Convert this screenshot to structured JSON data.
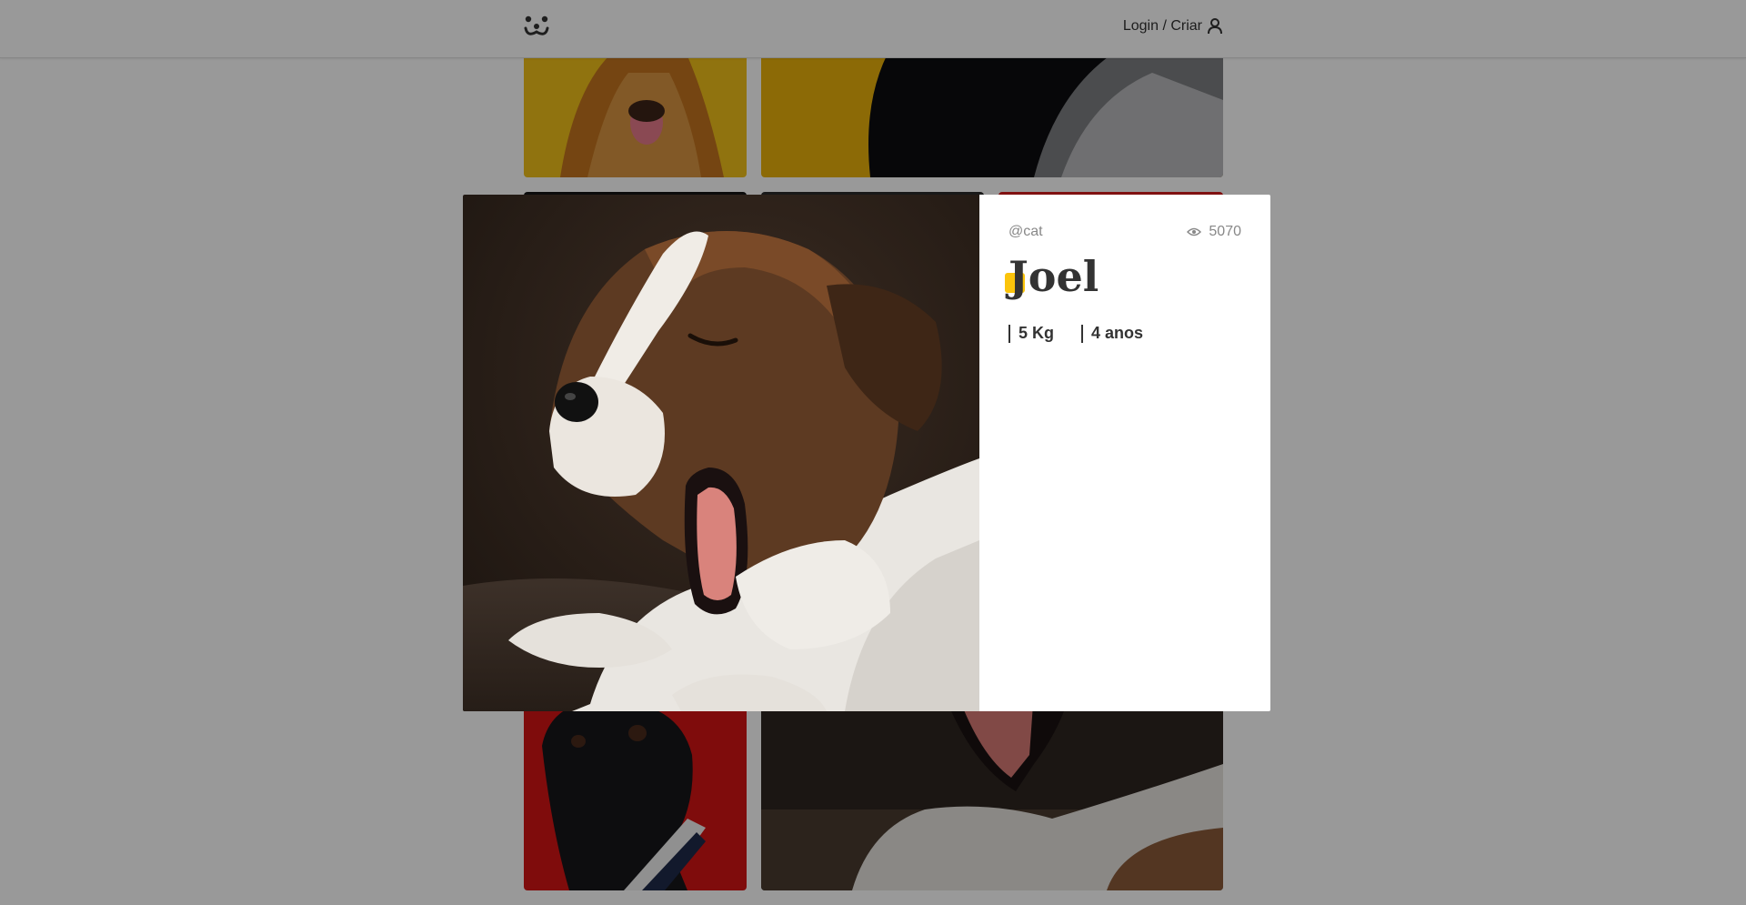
{
  "header": {
    "logo_icon": "dog-face-icon",
    "login_label": "Login / Criar",
    "user_icon": "user-icon"
  },
  "modal": {
    "author": "@cat",
    "views": "5070",
    "views_icon": "eye-icon",
    "title": "Joel",
    "weight": "5 Kg",
    "age": "4 anos"
  },
  "colors": {
    "accent": "#fbc40b",
    "text": "#333333",
    "muted": "#888888",
    "overlay": "rgba(0,0,0,0.4)"
  }
}
